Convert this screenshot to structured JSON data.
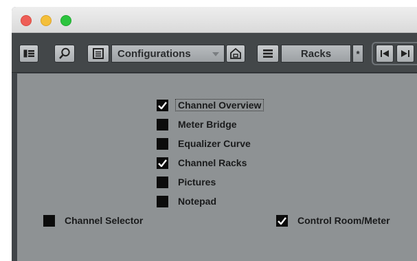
{
  "toolbar": {
    "configurations_label": "Configurations",
    "racks_label": "Racks",
    "star_label": "*"
  },
  "options": [
    {
      "label": "Channel Overview",
      "checked": true
    },
    {
      "label": "Meter Bridge",
      "checked": false
    },
    {
      "label": "Equalizer Curve",
      "checked": false
    },
    {
      "label": "Channel Racks",
      "checked": true
    },
    {
      "label": "Pictures",
      "checked": false
    },
    {
      "label": "Notepad",
      "checked": false
    }
  ],
  "extra_options": [
    {
      "label": "Channel Selector",
      "checked": false
    },
    {
      "label": "Control Room/Meter",
      "checked": true
    }
  ],
  "colors": {
    "toolbar_bg": "#434749",
    "panel_bg": "#8e9294",
    "checkbox": "#0c0c0c"
  }
}
